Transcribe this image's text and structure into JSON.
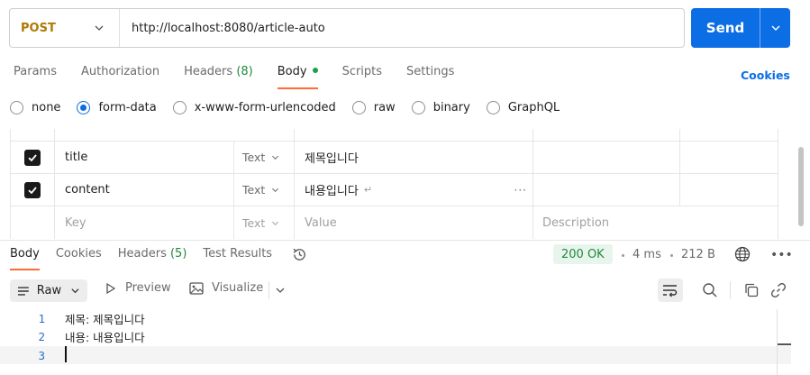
{
  "request": {
    "method": "POST",
    "url": "http://localhost:8080/article-auto",
    "send_label": "Send"
  },
  "request_tabs": [
    {
      "label": "Params"
    },
    {
      "label": "Authorization"
    },
    {
      "label": "Headers",
      "count": "(8)"
    },
    {
      "label": "Body"
    },
    {
      "label": "Scripts"
    },
    {
      "label": "Settings"
    }
  ],
  "cookies_link": "Cookies",
  "body_types": [
    {
      "label": "none",
      "checked": false
    },
    {
      "label": "form-data",
      "checked": true
    },
    {
      "label": "x-www-form-urlencoded",
      "checked": false
    },
    {
      "label": "raw",
      "checked": false
    },
    {
      "label": "binary",
      "checked": false
    },
    {
      "label": "GraphQL",
      "checked": false
    }
  ],
  "form_rows": [
    {
      "checked": true,
      "key": "title",
      "type": "Text",
      "value": "제목입니다",
      "description": ""
    },
    {
      "checked": true,
      "key": "content",
      "type": "Text",
      "value": "내용입니다",
      "description": ""
    }
  ],
  "form_new_row": {
    "key_placeholder": "Key",
    "type": "Text",
    "value_placeholder": "Value",
    "description_placeholder": "Description"
  },
  "response_tabs": [
    {
      "label": "Body"
    },
    {
      "label": "Cookies"
    },
    {
      "label": "Headers",
      "count": "(5)"
    },
    {
      "label": "Test Results"
    }
  ],
  "response_meta": {
    "status": "200 OK",
    "time": "4 ms",
    "size": "212 B"
  },
  "response_toolbar": {
    "format": "Raw",
    "preview": "Preview",
    "visualize": "Visualize"
  },
  "response_lines": [
    {
      "num": "1",
      "text": "제목: 제목입니다"
    },
    {
      "num": "2",
      "text": "내용: 내용입니다"
    },
    {
      "num": "3",
      "text": ""
    }
  ],
  "colors": {
    "accent": "#0c6ee4",
    "tab_underline": "#ff6c37",
    "method": "#ad7a03",
    "status_ok": "#1f8a3b"
  }
}
